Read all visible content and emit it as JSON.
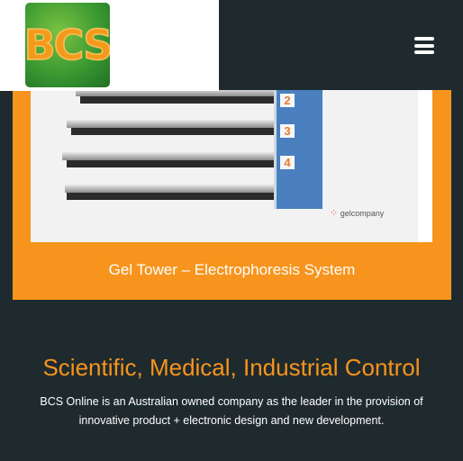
{
  "header": {
    "logo_text": "BCS",
    "menu_icon": "hamburger-menu-icon"
  },
  "slide": {
    "caption": "Gel Tower – Electrophoresis System",
    "drawer_numbers": [
      "2",
      "3",
      "4"
    ],
    "brand": "gelcompany"
  },
  "about": {
    "headline": "Scientific, Medical, Industrial Control",
    "description": "BCS Online is an Australian owned company as the leader in the provision of innovative product + electronic design and new development."
  },
  "colors": {
    "accent": "#f7941d",
    "background": "#1f2a2e",
    "logo_green": "#3b9a32"
  }
}
